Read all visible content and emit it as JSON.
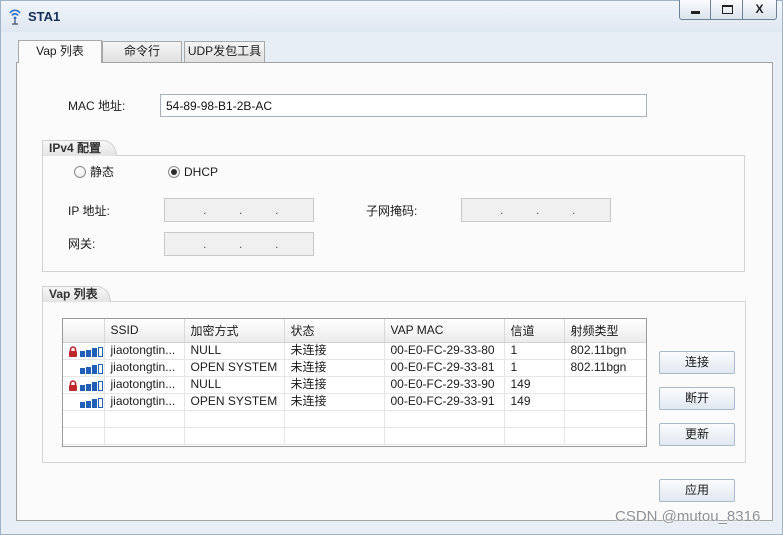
{
  "window": {
    "title": "STA1",
    "title_icon": "station-wifi-icon",
    "minimize_icon": "minimize-icon",
    "maximize_icon": "maximize-icon",
    "close_label": "X"
  },
  "tabs": [
    {
      "label": "Vap 列表",
      "active": true
    },
    {
      "label": "命令行",
      "active": false
    },
    {
      "label": "UDP发包工具",
      "active": false
    }
  ],
  "mac": {
    "label": "MAC 地址:",
    "value": "54-89-98-B1-2B-AC"
  },
  "ipv4": {
    "title": "IPv4 配置",
    "modes": [
      {
        "label": "静态",
        "selected": false
      },
      {
        "label": "DHCP",
        "selected": true
      }
    ],
    "ip_label": "IP 地址:",
    "mask_label": "子网掩码:",
    "gateway_label": "网关:",
    "separator": "."
  },
  "vap": {
    "title": "Vap 列表",
    "columns": [
      "SSID",
      "加密方式",
      "状态",
      "VAP MAC",
      "信道",
      "射频类型"
    ],
    "rows": [
      {
        "locked": true,
        "signal_level": 3,
        "ssid": "jiaotongtin...",
        "encryption": "NULL",
        "status": "未连接",
        "mac": "00-E0-FC-29-33-80",
        "channel": "1",
        "radio": "802.11bgn"
      },
      {
        "locked": false,
        "signal_level": 3,
        "ssid": "jiaotongtin...",
        "encryption": "OPEN SYSTEM",
        "status": "未连接",
        "mac": "00-E0-FC-29-33-81",
        "channel": "1",
        "radio": "802.11bgn"
      },
      {
        "locked": true,
        "signal_level": 3,
        "ssid": "jiaotongtin...",
        "encryption": "NULL",
        "status": "未连接",
        "mac": "00-E0-FC-29-33-90",
        "channel": "149",
        "radio": ""
      },
      {
        "locked": false,
        "signal_level": 3,
        "ssid": "jiaotongtin...",
        "encryption": "OPEN SYSTEM",
        "status": "未连接",
        "mac": "00-E0-FC-29-33-91",
        "channel": "149",
        "radio": ""
      }
    ]
  },
  "buttons": {
    "connect": "连接",
    "disconnect": "断开",
    "refresh": "更新",
    "apply": "应用"
  },
  "watermark": "CSDN @mutou_8316",
  "colors": {
    "signal": "#1f5fb8",
    "lock": "#c0282d",
    "title": "#15305a"
  }
}
